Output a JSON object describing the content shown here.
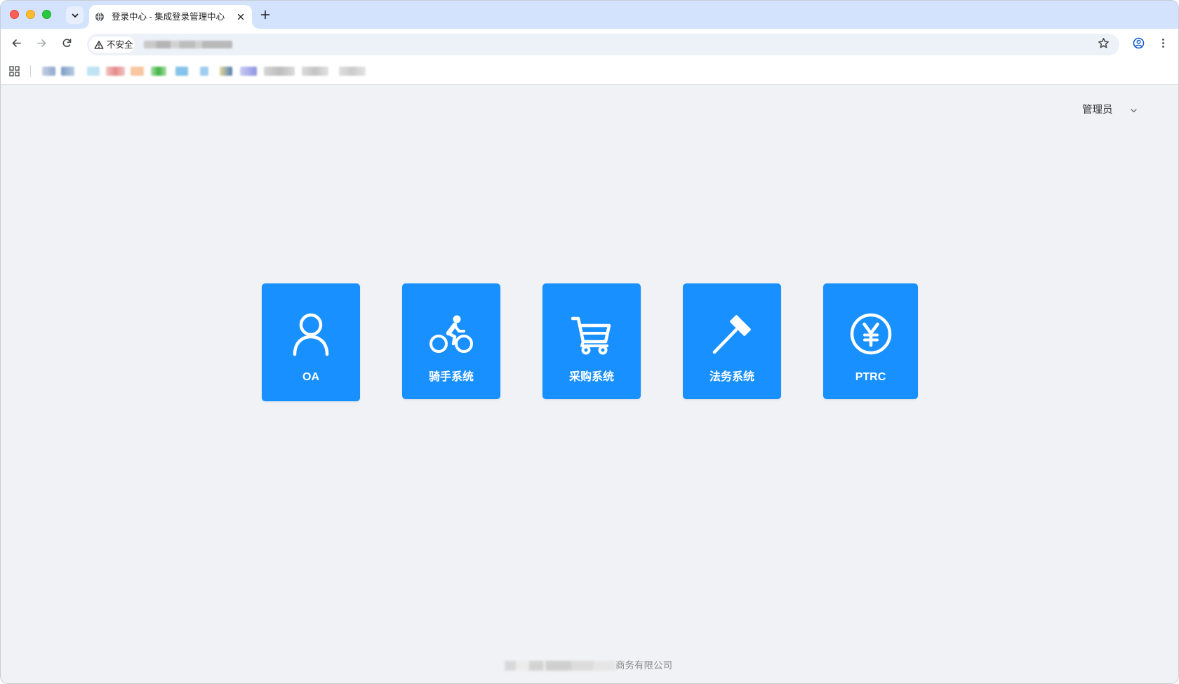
{
  "browser": {
    "tab_title": "登录中心 - 集成登录管理中心",
    "security_label": "不安全",
    "icons": {
      "tab_favicon": "globe-icon",
      "tab_close": "close-icon",
      "new_tab": "plus-icon",
      "back": "back-arrow-icon",
      "forward": "forward-arrow-icon",
      "reload": "reload-icon",
      "security": "warning-icon",
      "bookmark": "star-icon",
      "profile": "profile-icon",
      "menu": "more-vert-icon",
      "apps": "apps-grid-icon"
    }
  },
  "header": {
    "user_name": "管理员",
    "user_menu_icon": "chevron-down-icon"
  },
  "systems": [
    {
      "label": "OA",
      "icon": "user-icon"
    },
    {
      "label": "骑手系统",
      "icon": "bike-rider-icon"
    },
    {
      "label": "采购系统",
      "icon": "shopping-cart-icon"
    },
    {
      "label": "法务系统",
      "icon": "gavel-icon"
    },
    {
      "label": "PTRC",
      "icon": "yen-circle-icon"
    }
  ],
  "footer": {
    "company_suffix": "商务有限公司"
  },
  "colors": {
    "accent": "#1890ff",
    "page_background": "#f0f2f5",
    "tab_strip": "#d3e3fd"
  }
}
